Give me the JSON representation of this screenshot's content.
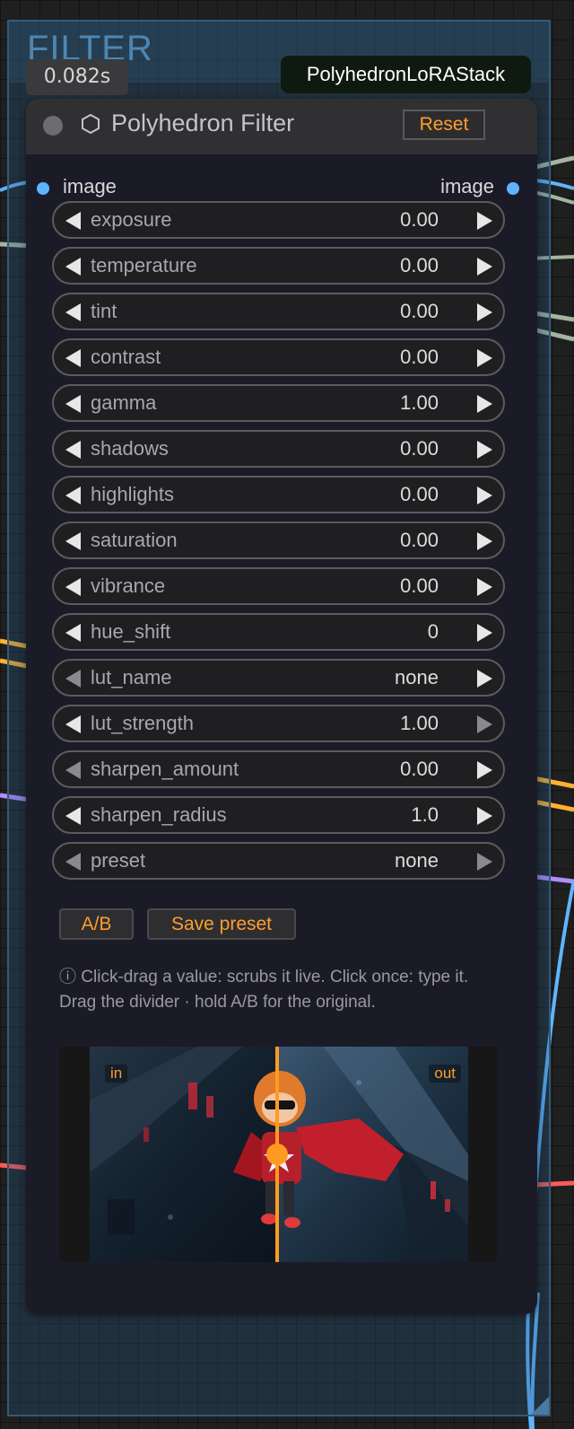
{
  "group": {
    "title": "FILTER"
  },
  "execution_time": "0.082s",
  "badge": "PolyhedronLoRAStack",
  "node": {
    "title": "Polyhedron Filter",
    "icon": "hexagon-icon",
    "reset_label": "Reset",
    "input_slot": "image",
    "output_slot": "image",
    "widgets": [
      {
        "name": "exposure",
        "value": "0.00"
      },
      {
        "name": "temperature",
        "value": "0.00"
      },
      {
        "name": "tint",
        "value": "0.00"
      },
      {
        "name": "contrast",
        "value": "0.00"
      },
      {
        "name": "gamma",
        "value": "1.00"
      },
      {
        "name": "shadows",
        "value": "0.00"
      },
      {
        "name": "highlights",
        "value": "0.00"
      },
      {
        "name": "saturation",
        "value": "0.00"
      },
      {
        "name": "vibrance",
        "value": "0.00"
      },
      {
        "name": "hue_shift",
        "value": "0"
      },
      {
        "name": "lut_name",
        "value": "none"
      },
      {
        "name": "lut_strength",
        "value": "1.00"
      },
      {
        "name": "sharpen_amount",
        "value": "0.00"
      },
      {
        "name": "sharpen_radius",
        "value": "1.0"
      },
      {
        "name": "preset",
        "value": "none"
      }
    ],
    "ab_label": "A/B",
    "save_preset_label": "Save preset",
    "hint_line1": "ⓘ Click-drag a value: scrubs it live. Click once: type it.",
    "hint_line2": "Drag the divider · hold A/B for the original.",
    "preview": {
      "in_label": "in",
      "out_label": "out"
    }
  },
  "colors": {
    "accent": "#ff9d2e",
    "slot": "#5fb4ff",
    "node_bg": "#1b1b28",
    "group_border": "#335a78"
  }
}
